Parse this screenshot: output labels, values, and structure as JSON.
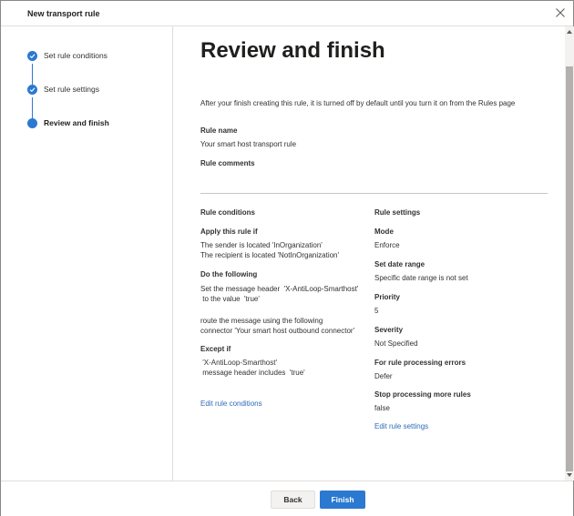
{
  "window": {
    "title": "New transport rule"
  },
  "steps": [
    {
      "label": "Set rule conditions",
      "state": "completed"
    },
    {
      "label": "Set rule settings",
      "state": "completed"
    },
    {
      "label": "Review and finish",
      "state": "current"
    }
  ],
  "main": {
    "title": "Review and finish",
    "intro": "After your finish creating this rule, it is turned off by default until you turn it on from the Rules page",
    "rule_name_label": "Rule name",
    "rule_name_value": "Your smart host transport rule",
    "rule_comments_label": "Rule comments",
    "conditions": {
      "heading": "Rule conditions",
      "apply_label": "Apply this rule if",
      "apply_lines": [
        "The sender is located 'InOrganization'",
        "The recipient is located 'NotInOrganization'"
      ],
      "do_label": "Do the following",
      "do_lines": [
        "Set the message header  'X-AntiLoop-Smarthost'",
        " to the value  'true'",
        "",
        "route the message using the following",
        "connector 'Your smart host outbound connector'"
      ],
      "except_label": "Except if",
      "except_lines": [
        " 'X-AntiLoop-Smarthost'",
        " message header includes  'true'"
      ],
      "edit_link": "Edit rule conditions"
    },
    "settings": {
      "heading": "Rule settings",
      "mode_label": "Mode",
      "mode_value": "Enforce",
      "date_label": "Set date range",
      "date_value": "Specific date range is not set",
      "priority_label": "Priority",
      "priority_value": "5",
      "severity_label": "Severity",
      "severity_value": "Not Specified",
      "errors_label": "For rule processing errors",
      "errors_value": "Defer",
      "stop_label": "Stop processing more rules",
      "stop_value": "false",
      "edit_link": "Edit rule settings"
    }
  },
  "footer": {
    "back_label": "Back",
    "finish_label": "Finish"
  },
  "colors": {
    "accent": "#2b79d0",
    "link": "#2b6cb8",
    "divider": "#c8c6c4"
  },
  "icons": {
    "close": "close-icon",
    "check": "checkmark-icon"
  }
}
